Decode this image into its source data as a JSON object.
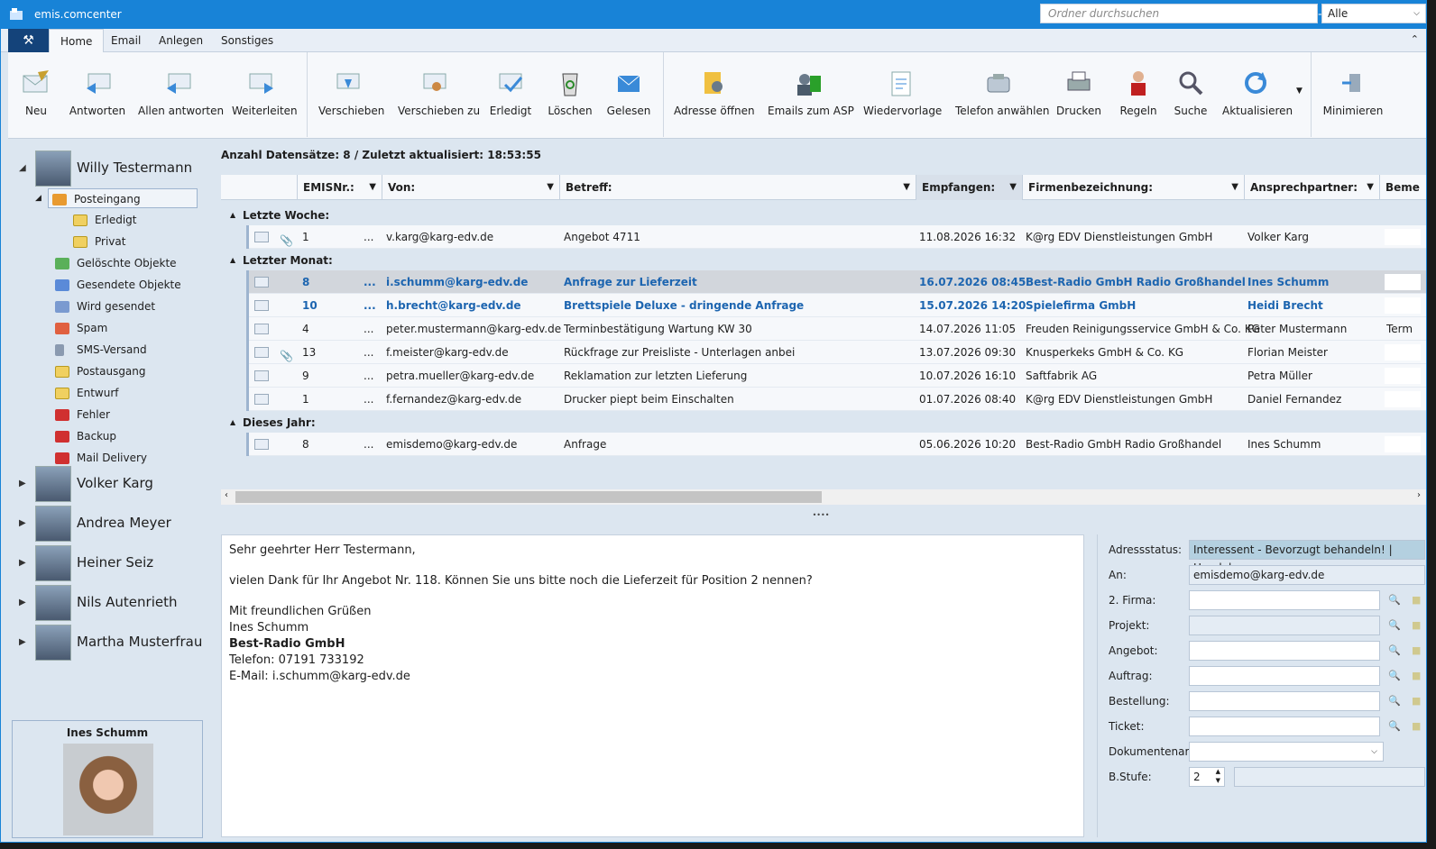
{
  "window": {
    "title": "emis.comcenter"
  },
  "menu": {
    "tabs": [
      "Home",
      "Email",
      "Anlegen",
      "Sonstiges"
    ]
  },
  "ribbon": {
    "buttons": [
      {
        "label": "Neu"
      },
      {
        "label": "Antworten"
      },
      {
        "label": "Allen antworten"
      },
      {
        "label": "Weiterleiten"
      },
      {
        "label": "Verschieben"
      },
      {
        "label": "Verschieben zu"
      },
      {
        "label": "Erledigt"
      },
      {
        "label": "Löschen"
      },
      {
        "label": "Gelesen"
      },
      {
        "label": "Adresse öffnen"
      },
      {
        "label": "Emails zum ASP"
      },
      {
        "label": "Wiedervorlage"
      },
      {
        "label": "Telefon anwählen"
      },
      {
        "label": "Drucken"
      },
      {
        "label": "Regeln"
      },
      {
        "label": "Suche"
      },
      {
        "label": "Aktualisieren"
      },
      {
        "label": "Minimieren"
      }
    ]
  },
  "tree": {
    "user_main": "Willy Testermann",
    "folders": [
      "Posteingang",
      "Erledigt",
      "Privat",
      "Gelöschte Objekte",
      "Gesendete Objekte",
      "Wird gesendet",
      "Spam",
      "SMS-Versand",
      "Postausgang",
      "Entwurf",
      "Fehler",
      "Backup",
      "Mail Delivery"
    ],
    "other_users": [
      "Volker Karg",
      "Andrea Meyer",
      "Heiner Seiz",
      "Nils Autenrieth",
      "Martha Musterfrau"
    ]
  },
  "contact_card": {
    "name": "Ines Schumm"
  },
  "list": {
    "info": "Anzahl Datensätze: 8 / Zuletzt aktualisiert: 18:53:55",
    "search_placeholder": "Ordner durchsuchen",
    "filter": "Alle",
    "columns": [
      "EMISNr.:",
      "Von:",
      "Betreff:",
      "Empfangen:",
      "Firmenbezeichnung:",
      "Ansprechpartner:",
      "Beme"
    ],
    "groups": [
      {
        "label": "Letzte Woche:",
        "rows": [
          {
            "nr": "1",
            "dots": "...",
            "von": "v.karg@karg-edv.de",
            "betreff": "Angebot 4711",
            "empfangen": "11.08.2026 16:32",
            "firma": "K@rg EDV Dienstleistungen GmbH",
            "ansprech": "Volker Karg",
            "beme": ""
          }
        ]
      },
      {
        "label": "Letzter Monat:",
        "rows": [
          {
            "nr": "8",
            "dots": "...",
            "von": "i.schumm@karg-edv.de",
            "betreff": "Anfrage zur Lieferzeit",
            "empfangen": "16.07.2026 08:45",
            "firma": "Best-Radio GmbH Radio Großhandel",
            "ansprech": "Ines Schumm",
            "beme": ""
          },
          {
            "nr": "10",
            "dots": "...",
            "von": "h.brecht@karg-edv.de",
            "betreff": "Brettspiele Deluxe - dringende Anfrage",
            "empfangen": "15.07.2026 14:20",
            "firma": "Spielefirma GmbH",
            "ansprech": "Heidi Brecht",
            "beme": ""
          },
          {
            "nr": "4",
            "dots": "...",
            "von": "peter.mustermann@karg-edv.de",
            "betreff": "Terminbestätigung Wartung KW 30",
            "empfangen": "14.07.2026 11:05",
            "firma": "Freuden Reinigungsservice GmbH & Co. KG",
            "ansprech": "Peter Mustermann",
            "beme": "Term"
          },
          {
            "nr": "13",
            "dots": "...",
            "von": "f.meister@karg-edv.de",
            "betreff": "Rückfrage zur Preisliste - Unterlagen anbei",
            "empfangen": "13.07.2026 09:30",
            "firma": "Knusperkeks GmbH & Co. KG",
            "ansprech": "Florian Meister",
            "beme": ""
          },
          {
            "nr": "9",
            "dots": "...",
            "von": "petra.mueller@karg-edv.de",
            "betreff": "Reklamation zur letzten Lieferung",
            "empfangen": "10.07.2026 16:10",
            "firma": "Saftfabrik AG",
            "ansprech": "Petra Müller",
            "beme": ""
          },
          {
            "nr": "1",
            "dots": "...",
            "von": "f.fernandez@karg-edv.de",
            "betreff": "Drucker piept beim Einschalten",
            "empfangen": "01.07.2026 08:40",
            "firma": "K@rg EDV Dienstleistungen GmbH",
            "ansprech": "Daniel Fernandez",
            "beme": ""
          }
        ]
      },
      {
        "label": "Dieses Jahr:",
        "rows": [
          {
            "nr": "8",
            "dots": "...",
            "von": "emisdemo@karg-edv.de",
            "betreff": "Anfrage",
            "empfangen": "05.06.2026 10:20",
            "firma": "Best-Radio GmbH Radio Großhandel",
            "ansprech": "Ines Schumm",
            "beme": ""
          }
        ]
      }
    ]
  },
  "preview": {
    "greeting": "Sehr geehrter Herr Testermann,",
    "body": "vielen Dank für Ihr Angebot Nr. 118. Können Sie uns bitte noch die Lieferzeit für Position 2 nennen?",
    "closing": "Mit freundlichen Grüßen",
    "sig_name": "Ines Schumm",
    "sig_company": "Best-Radio GmbH",
    "sig_phone": "Telefon: 07191 733192",
    "sig_email": "E-Mail: i.schumm@karg-edv.de"
  },
  "props": {
    "adressstatus_label": "Adressstatus:",
    "adressstatus_value": "Interessent - Bevorzugt behandeln! | Handel",
    "an_label": "An:",
    "an_value": "emisdemo@karg-edv.de",
    "firma_label": "2. Firma:",
    "projekt_label": "Projekt:",
    "angebot_label": "Angebot:",
    "auftrag_label": "Auftrag:",
    "bestellung_label": "Bestellung:",
    "ticket_label": "Ticket:",
    "dokart_label": "Dokumentenart:",
    "bstufe_label": "B.Stufe:",
    "bstufe_value": "2"
  },
  "colors": {
    "accent": "#1883d7",
    "unread": "#1d65b0",
    "pane": "#dce6f0"
  }
}
